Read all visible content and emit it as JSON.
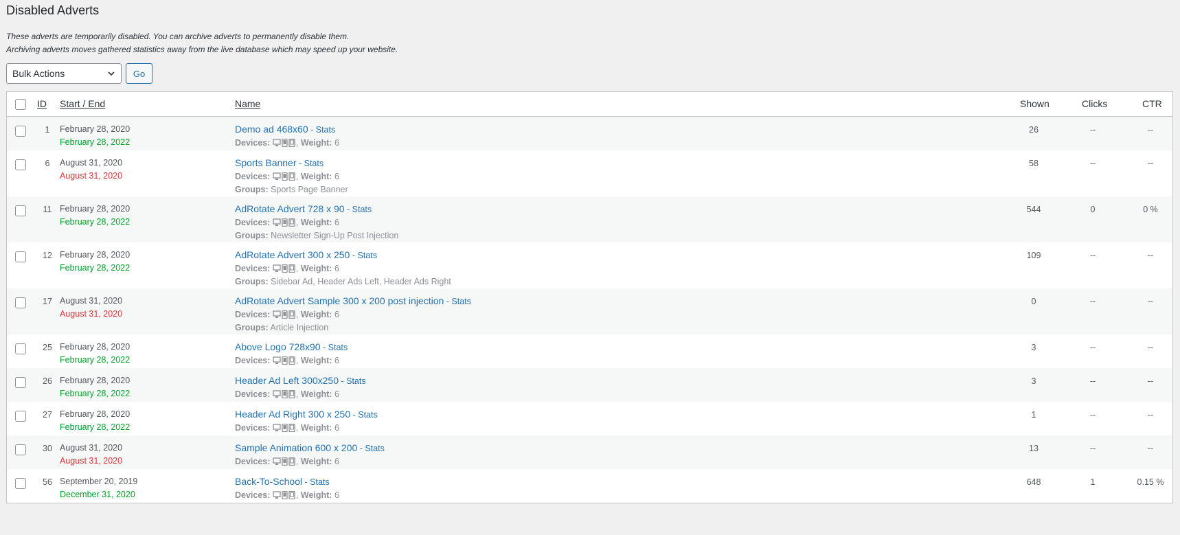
{
  "page": {
    "title": "Disabled Adverts",
    "desc_line1": "These adverts are temporarily disabled. You can archive adverts to permanently disable them.",
    "desc_line2": "Archiving adverts moves gathered statistics away from the live database which may speed up your website."
  },
  "bulk": {
    "selected": "Bulk Actions",
    "go_label": "Go"
  },
  "columns": {
    "id": "ID",
    "start_end": "Start / End",
    "name": "Name",
    "shown": "Shown",
    "clicks": "Clicks",
    "ctr": "CTR"
  },
  "labels": {
    "devices": "Devices:",
    "weight": "Weight:",
    "groups": "Groups:",
    "stats": "Stats",
    "dash": " - "
  },
  "colors": {
    "link": "#2271b1",
    "end_active": "#00a32a",
    "end_expired": "#d63638"
  },
  "rows": [
    {
      "id": "1",
      "start": "February 28, 2020",
      "end": "February 28, 2022",
      "end_status": "active",
      "name": "Demo ad 468x60",
      "weight": "6",
      "groups": "",
      "shown": "26",
      "clicks": "--",
      "ctr": "--"
    },
    {
      "id": "6",
      "start": "August 31, 2020",
      "end": "August 31, 2020",
      "end_status": "expired",
      "name": "Sports Banner",
      "weight": "6",
      "groups": "Sports Page Banner",
      "shown": "58",
      "clicks": "--",
      "ctr": "--"
    },
    {
      "id": "11",
      "start": "February 28, 2020",
      "end": "February 28, 2022",
      "end_status": "active",
      "name": "AdRotate Advert 728 x 90",
      "weight": "6",
      "groups": "Newsletter Sign-Up Post Injection",
      "shown": "544",
      "clicks": "0",
      "ctr": "0 %"
    },
    {
      "id": "12",
      "start": "February 28, 2020",
      "end": "February 28, 2022",
      "end_status": "active",
      "name": "AdRotate Advert 300 x 250",
      "weight": "6",
      "groups": "Sidebar Ad, Header Ads Left, Header Ads Right",
      "shown": "109",
      "clicks": "--",
      "ctr": "--"
    },
    {
      "id": "17",
      "start": "August 31, 2020",
      "end": "August 31, 2020",
      "end_status": "expired",
      "name": "AdRotate Advert Sample 300 x 200 post injection",
      "weight": "6",
      "groups": "Article Injection",
      "shown": "0",
      "clicks": "--",
      "ctr": "--"
    },
    {
      "id": "25",
      "start": "February 28, 2020",
      "end": "February 28, 2022",
      "end_status": "active",
      "name": "Above Logo 728x90",
      "weight": "6",
      "groups": "",
      "shown": "3",
      "clicks": "--",
      "ctr": "--"
    },
    {
      "id": "26",
      "start": "February 28, 2020",
      "end": "February 28, 2022",
      "end_status": "active",
      "name": "Header Ad Left 300x250",
      "weight": "6",
      "groups": "",
      "shown": "3",
      "clicks": "--",
      "ctr": "--"
    },
    {
      "id": "27",
      "start": "February 28, 2020",
      "end": "February 28, 2022",
      "end_status": "active",
      "name": "Header Ad Right 300 x 250",
      "weight": "6",
      "groups": "",
      "shown": "1",
      "clicks": "--",
      "ctr": "--"
    },
    {
      "id": "30",
      "start": "August 31, 2020",
      "end": "August 31, 2020",
      "end_status": "expired",
      "name": "Sample Animation 600 x 200",
      "weight": "6",
      "groups": "",
      "shown": "13",
      "clicks": "--",
      "ctr": "--"
    },
    {
      "id": "56",
      "start": "September 20, 2019",
      "end": "December 31, 2020",
      "end_status": "active",
      "name": "Back-To-School",
      "weight": "6",
      "groups": "",
      "shown": "648",
      "clicks": "1",
      "ctr": "0.15 %"
    }
  ]
}
